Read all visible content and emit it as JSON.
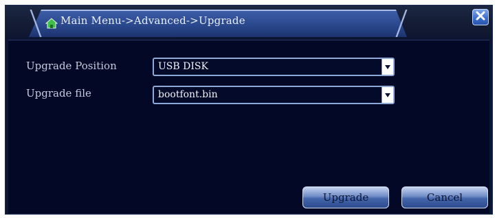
{
  "window": {
    "title": "Main Menu->Advanced->Upgrade"
  },
  "icons": {
    "title_icon": "home-icon",
    "close": "close-icon",
    "dropdown": "chevron-down-icon"
  },
  "form": {
    "upgrade_position": {
      "label": "Upgrade Position",
      "value": "USB DISK"
    },
    "upgrade_file": {
      "label": "Upgrade file",
      "value": "bootfont.bin"
    }
  },
  "buttons": {
    "upgrade_label": "Upgrade",
    "cancel_label": "Cancel"
  },
  "colors": {
    "background": "#020826",
    "accent": "#3c5da6",
    "text": "#c3cbdc"
  }
}
